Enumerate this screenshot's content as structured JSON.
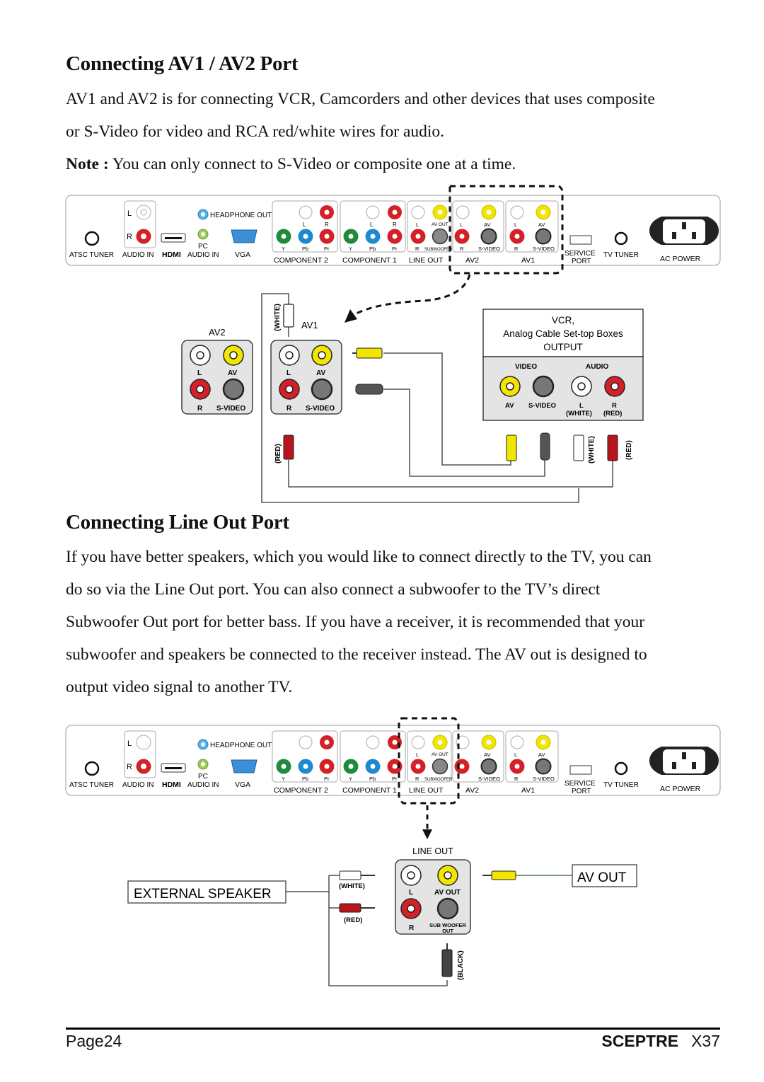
{
  "section1": {
    "heading": "Connecting AV1 / AV2 Port",
    "body_lines": [
      "AV1 and AV2 is for connecting VCR, Camcorders and other devices that uses composite",
      "or S-Video for video and RCA red/white wires for audio."
    ],
    "note_label": "Note :",
    "note_text": " You can only connect to S-Video or composite one at a time."
  },
  "panel": {
    "atsc_tuner": "ATSC TUNER",
    "audio_in": "AUDIO IN",
    "hdmi": "HDMI",
    "pc": "PC",
    "audio_in_pc": "AUDIO IN",
    "vga": "VGA",
    "headphone_out": "HEADPHONE OUT",
    "component2": "COMPONENT 2",
    "component1": "COMPONENT 1",
    "line_out": "LINE OUT",
    "av2": "AV2",
    "av1": "AV1",
    "service": "SERVICE",
    "port": "PORT",
    "tv_tuner": "TV TUNER",
    "ac_power": "AC POWER",
    "l": "L",
    "r": "R",
    "y": "Y",
    "pb": "Pb",
    "pr": "Pr",
    "av": "AV",
    "av_out": "AV OUT",
    "subwoofer": "SUBWOOFER",
    "s_video": "S-VIDEO"
  },
  "diagram1": {
    "av2_title": "AV2",
    "av1_title": "AV1",
    "l": "L",
    "r": "R",
    "av": "AV",
    "s_video": "S-VIDEO",
    "white": "(WHITE)",
    "red": "(RED)",
    "vcr_title_1": "VCR,",
    "vcr_title_2": "Analog Cable Set-top Boxes",
    "vcr_title_3": "OUTPUT",
    "video": "VIDEO",
    "audio": "AUDIO",
    "vcr_av": "AV",
    "vcr_svideo": "S-VIDEO",
    "vcr_l": "L",
    "vcr_r": "R",
    "vcr_white": "(WHITE)",
    "vcr_red": "(RED)"
  },
  "section2": {
    "heading": "Connecting Line Out Port",
    "body_lines": [
      "If you have better speakers, which you would like to connect directly to the TV, you can",
      "do so via the Line Out port. You can also connect a subwoofer to the TV’s direct",
      "Subwoofer Out port for better bass. If you have a receiver, it is recommended that your",
      "subwoofer and speakers be connected to the receiver instead. The AV out is designed to",
      "output video signal to another TV."
    ]
  },
  "diagram2": {
    "line_out_title": "LINE OUT",
    "l": "L",
    "r": "R",
    "av_out": "AV OUT",
    "sub_woofer": "SUB WOOFER",
    "out": "OUT",
    "external_speaker": "EXTERNAL SPEAKER",
    "white": "(WHITE)",
    "red": "(RED)",
    "black": "(BLACK)",
    "av_out_box": "AV OUT"
  },
  "footer": {
    "page": "Page24",
    "brand": "SCEPTRE",
    "model": "X37"
  },
  "colors": {
    "red": "#d42027",
    "white_jack": "#ffffff",
    "yellow": "#f2e600",
    "green": "#1f8a3a",
    "blue": "#1e88d0",
    "gray_panel": "#e4e4e4",
    "svideo": "#666666",
    "headphone": "#52b5e8",
    "pc_audio": "#9ccc5a"
  }
}
